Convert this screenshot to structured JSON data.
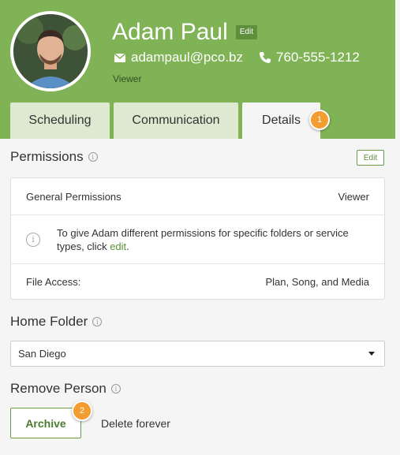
{
  "profile": {
    "name": "Adam Paul",
    "edit_label": "Edit",
    "email": "adampaul@pco.bz",
    "phone": "760-555-1212",
    "role": "Viewer"
  },
  "tabs": [
    {
      "label": "Scheduling",
      "active": false
    },
    {
      "label": "Communication",
      "active": false
    },
    {
      "label": "Details",
      "active": true
    }
  ],
  "tour": {
    "badge1": "1",
    "badge2": "2"
  },
  "permissions": {
    "title": "Permissions",
    "edit_label": "Edit",
    "general_label": "General Permissions",
    "general_value": "Viewer",
    "hint_prefix": "To give Adam different permissions for specific folders or service types, click ",
    "hint_link": "edit",
    "hint_suffix": ".",
    "file_access_label": "File Access:",
    "file_access_value": "Plan, Song, and Media"
  },
  "home_folder": {
    "title": "Home Folder",
    "selected": "San Diego"
  },
  "remove_person": {
    "title": "Remove Person",
    "archive_label": "Archive",
    "delete_label": "Delete forever"
  },
  "colors": {
    "header_bg": "#7fb356",
    "tab_inactive": "#ddead1",
    "accent_green": "#5d8f3c",
    "tour_orange": "#f39c30"
  },
  "icons": {
    "email": "envelope-icon",
    "phone": "phone-icon",
    "info": "info-icon",
    "dropdown": "caret-down-icon"
  }
}
